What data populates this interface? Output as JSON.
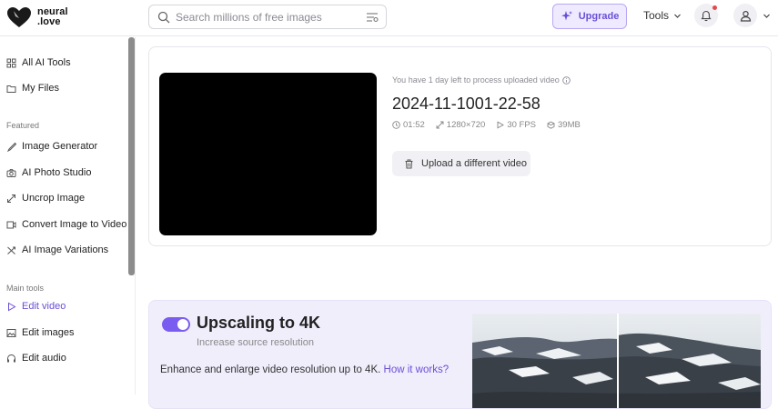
{
  "header": {
    "logo_line1": "neural",
    "logo_line2": ".love",
    "search_placeholder": "Search millions of free images",
    "upgrade_label": "Upgrade",
    "tools_label": "Tools"
  },
  "sidebar": {
    "top_items": [
      {
        "label": "All AI Tools",
        "icon": "grid-icon"
      },
      {
        "label": "My Files",
        "icon": "folder-icon"
      }
    ],
    "featured_label": "Featured",
    "featured_items": [
      {
        "label": "Image Generator",
        "icon": "brush-icon"
      },
      {
        "label": "AI Photo Studio",
        "icon": "camera-icon"
      },
      {
        "label": "Uncrop Image",
        "icon": "expand-icon"
      },
      {
        "label": "Convert Image to Video",
        "icon": "video-convert-icon"
      },
      {
        "label": "AI Image Variations",
        "icon": "shuffle-icon"
      }
    ],
    "main_tools_label": "Main tools",
    "main_tools_items": [
      {
        "label": "Edit video",
        "icon": "play-icon",
        "active": true
      },
      {
        "label": "Edit images",
        "icon": "image-icon"
      },
      {
        "label": "Edit audio",
        "icon": "headphones-icon"
      }
    ]
  },
  "video_card": {
    "notice": "You have 1 day left to process uploaded video",
    "title": "2024-11-1001-22-58",
    "duration": "01:52",
    "resolution": "1280×720",
    "fps": "30 FPS",
    "size": "39MB",
    "upload_button": "Upload a different video"
  },
  "upscale_card": {
    "title": "Upscaling to 4K",
    "subtitle": "Increase source resolution",
    "description": "Enhance and enlarge video resolution up to 4K.",
    "link": "How it works?",
    "toggle_on": true
  },
  "colors": {
    "accent": "#6a4fd6",
    "toggle": "#7b5cf0",
    "card_bg": "#f1eefc"
  }
}
